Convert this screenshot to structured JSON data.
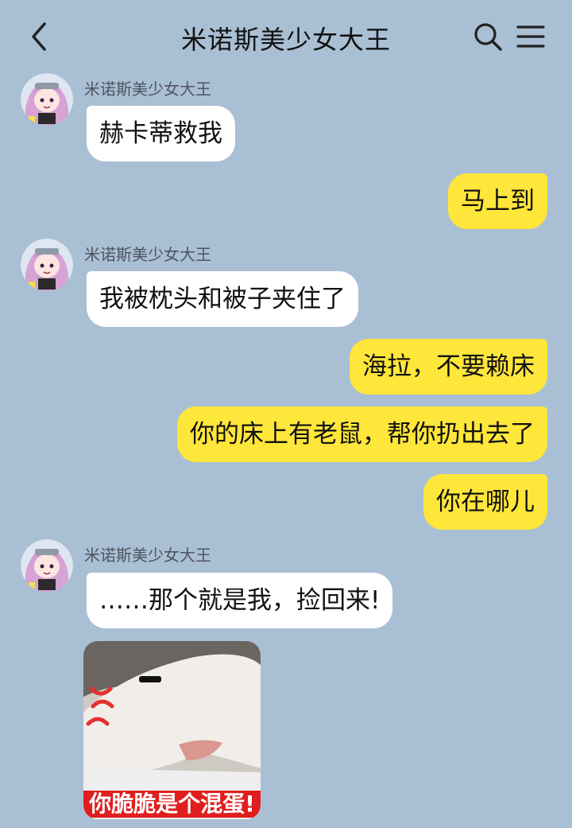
{
  "header": {
    "title": "米诺斯美少女大王",
    "back_icon": "chevron-left-icon",
    "search_icon": "search-icon",
    "menu_icon": "menu-icon"
  },
  "colors": {
    "background": "#a9bfd4",
    "incoming_bubble": "#ffffff",
    "outgoing_bubble": "#ffe63a"
  },
  "messages": [
    {
      "sender": "米诺斯美少女大王",
      "text": "赫卡蒂救我",
      "direction": "incoming"
    },
    {
      "text": "马上到",
      "direction": "outgoing"
    },
    {
      "sender": "米诺斯美少女大王",
      "text": "我被枕头和被子夹住了",
      "direction": "incoming"
    },
    {
      "text": "海拉，不要赖床",
      "direction": "outgoing"
    },
    {
      "text": "你的床上有老鼠，帮你扔出去了",
      "direction": "outgoing"
    },
    {
      "text": "你在哪儿",
      "direction": "outgoing"
    },
    {
      "sender": "米诺斯美少女大王",
      "text": "……那个就是我，捡回来!",
      "direction": "incoming"
    }
  ],
  "sticker": {
    "caption": "你脆脆是个混蛋!"
  }
}
